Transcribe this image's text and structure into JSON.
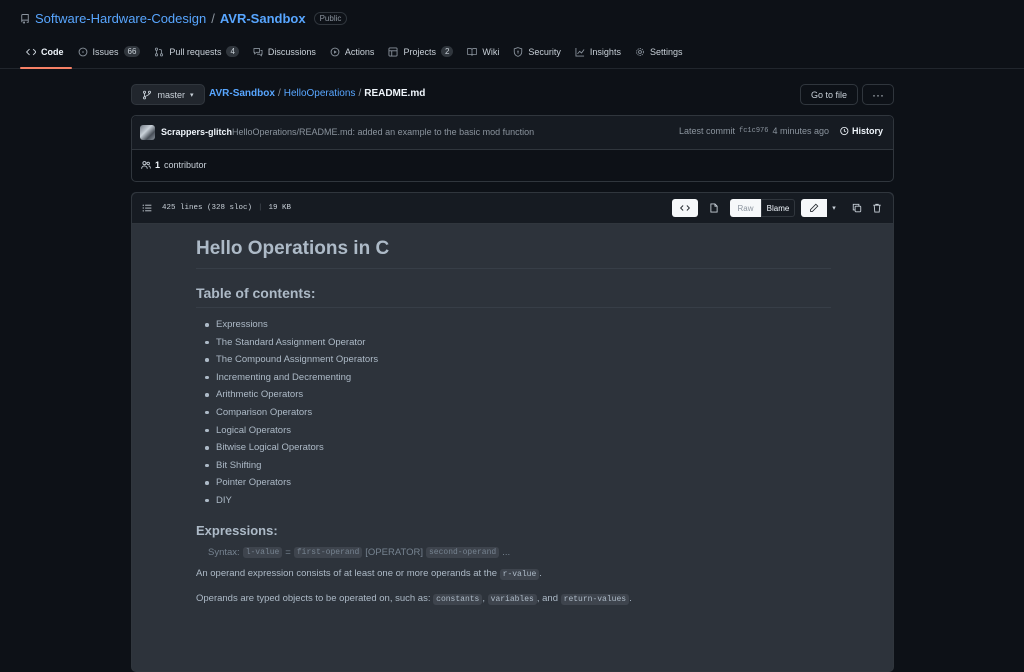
{
  "repo": {
    "owner": "Software-Hardware-Codesign",
    "separator": "/",
    "name": "AVR-Sandbox",
    "visibility": "Public"
  },
  "tabs": [
    {
      "label": "Code",
      "icon": "code-icon",
      "count": ""
    },
    {
      "label": "Issues",
      "icon": "issue-icon",
      "count": "66"
    },
    {
      "label": "Pull requests",
      "icon": "pull-request-icon",
      "count": "4"
    },
    {
      "label": "Discussions",
      "icon": "discussion-icon",
      "count": ""
    },
    {
      "label": "Actions",
      "icon": "play-icon",
      "count": ""
    },
    {
      "label": "Projects",
      "icon": "table-icon",
      "count": "2"
    },
    {
      "label": "Wiki",
      "icon": "book-icon",
      "count": ""
    },
    {
      "label": "Security",
      "icon": "shield-icon",
      "count": ""
    },
    {
      "label": "Insights",
      "icon": "graph-icon",
      "count": ""
    },
    {
      "label": "Settings",
      "icon": "gear-icon",
      "count": ""
    }
  ],
  "path": {
    "branch": "master",
    "root": "AVR-Sandbox",
    "dir": "HelloOperations",
    "file": "README.md",
    "sep": "/",
    "goto_file": "Go to file",
    "more": "···"
  },
  "commit": {
    "author": "Scrappers-glitch",
    "message": "HelloOperations/README.md: added an example to the basic mod function",
    "latest_label": "Latest commit",
    "sha": "fc1c976",
    "time": "4 minutes ago",
    "history": "History",
    "contributors_count": "1",
    "contributors_label": "contributor"
  },
  "file": {
    "lines": "425 lines (328 sloc)",
    "size": "19 KB",
    "raw": "Raw",
    "blame": "Blame"
  },
  "readme": {
    "h1": "Hello Operations in C",
    "toc_title": "Table of contents:",
    "toc": [
      "Expressions",
      "The Standard Assignment Operator",
      "The Compound Assignment Operators",
      "Incrementing and Decrementing",
      "Arithmetic Operators",
      "Comparison Operators",
      "Logical Operators",
      "Bitwise Logical Operators",
      "Bit Shifting",
      "Pointer Operators",
      "DIY"
    ],
    "expr_title": "Expressions:",
    "syntax": {
      "label": "Syntax:",
      "lvalue": "l-value",
      "eq": "=",
      "first": "first-operand",
      "op": "[OPERATOR]",
      "second": "second-operand",
      "ellipsis": "..."
    },
    "p1": {
      "text": "An operand expression consists of at least one or more operands at the",
      "code": "r-value",
      "end": "."
    },
    "p2": {
      "text": "Operands are typed objects to be operated on, such as:",
      "c1": "constants",
      "sep1": ",",
      "c2": "variables",
      "sep2": ", and",
      "c3": "return-values",
      "end": "."
    }
  }
}
